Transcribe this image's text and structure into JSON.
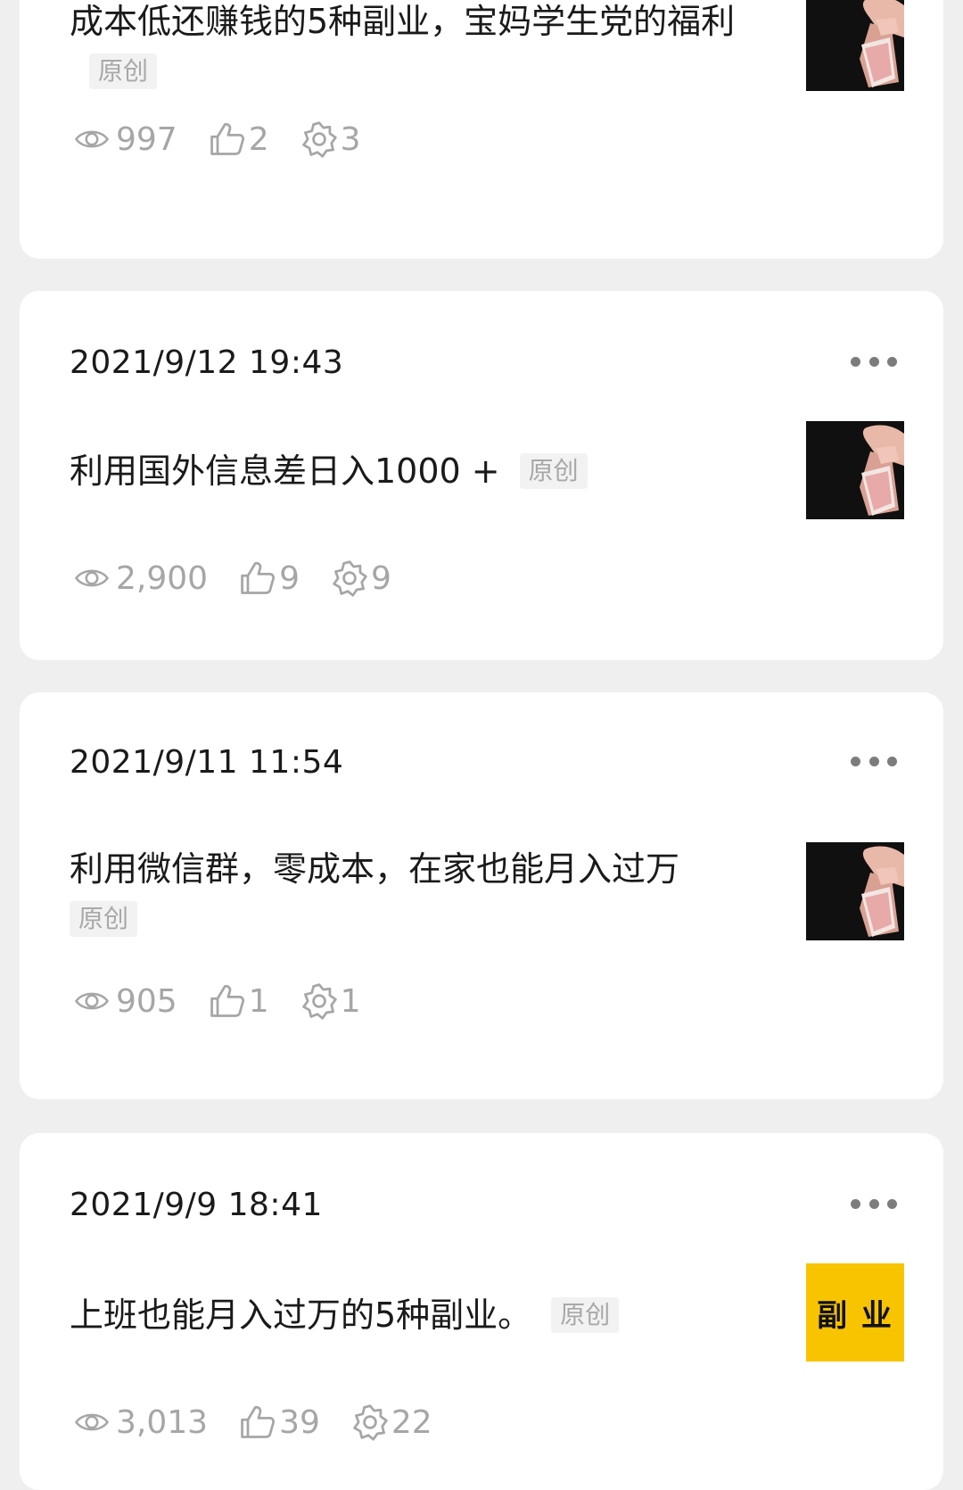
{
  "posts": [
    {
      "title": "成本低还赚钱的5种副业，宝妈学生党的福利",
      "tag": "原创",
      "views": "997",
      "likes": "2",
      "shares": "3"
    },
    {
      "date": "2021/9/12 19:43",
      "title": "利用国外信息差日入1000 +",
      "tag": "原创",
      "views": "2,900",
      "likes": "9",
      "shares": "9"
    },
    {
      "date": "2021/9/11 11:54",
      "title": "利用微信群，零成本，在家也能月入过万",
      "tag": "原创",
      "views": "905",
      "likes": "1",
      "shares": "1"
    },
    {
      "date": "2021/9/9 18:41",
      "title": "上班也能月入过万的5种副业。",
      "tag": "原创",
      "thumb_text": "副 业",
      "views": "3,013",
      "likes": "39",
      "shares": "22"
    }
  ],
  "icons": {
    "views": "eye-icon",
    "likes": "thumbs-up-icon",
    "shares": "share-gear-icon",
    "more": "more-dots-icon"
  },
  "colors": {
    "background": "#efefef",
    "card": "#ffffff",
    "text": "#1a1a1a",
    "muted": "#a6a6a6",
    "thumb_yellow": "#f8c400"
  }
}
